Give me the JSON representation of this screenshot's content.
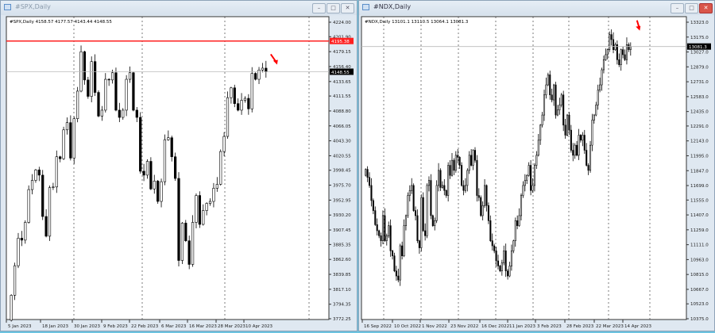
{
  "windows": [
    {
      "title": "#SPX,Daily",
      "info": "#SPX,Daily  4158.57 4177.57 4143.44 4148.55",
      "buttons": {
        "minimize": "–",
        "maximize": "□",
        "close": "✕"
      }
    },
    {
      "title": "#NDX,Daily",
      "info": "#NDX,Daily  13101.1 13110.5 13064.1 13081.3",
      "buttons": {
        "minimize": "–",
        "maximize": "□",
        "close": "✕"
      }
    }
  ],
  "chart_data": [
    {
      "type": "candlestick",
      "symbol": "#SPX",
      "timeframe": "Daily",
      "ylim": [
        3772.25,
        4224.0
      ],
      "price_ticks": [
        "4224.00",
        "4201.90",
        "4179.15",
        "4156.40",
        "4133.65",
        "4111.55",
        "4088.80",
        "4066.05",
        "4043.30",
        "4020.55",
        "3998.45",
        "3975.70",
        "3952.95",
        "3930.20",
        "3907.45",
        "3885.35",
        "3862.60",
        "3839.85",
        "3817.10",
        "3794.35",
        "3772.25"
      ],
      "date_ticks": [
        "5 Jan 2023",
        "18 Jan 2023",
        "30 Jan 2023",
        "9 Feb 2023",
        "22 Feb 2023",
        "6 Mar 2023",
        "16 Mar 2023",
        "28 Mar 2023",
        "10 Apr 2023"
      ],
      "current_price": "4148.55",
      "resistance_level": "4195.38",
      "resistance_color": "#ff2020",
      "arrow_color": "#ff0000",
      "arrow": "down-right",
      "close": [
        3808,
        3853,
        3895,
        3892,
        3919,
        3969,
        3983,
        3999,
        3991,
        3928,
        3898,
        3972,
        3973,
        4019,
        4016,
        4060,
        4071,
        4017,
        4077,
        4119,
        4179,
        4136,
        4111,
        4164,
        4117,
        4081,
        4090,
        4137,
        4136,
        4147,
        4090,
        4079,
        4090,
        4137,
        4147,
        4090,
        4079,
        3997,
        3991,
        4012,
        3970,
        3982,
        3951,
        3981,
        4045,
        4048,
        4019,
        3986,
        3861,
        3918,
        3891,
        3855,
        3919,
        3960,
        3916,
        3937,
        3948,
        3951,
        3971,
        3977,
        4027,
        4050,
        4109,
        4124,
        4100,
        4090,
        4105,
        4108,
        4092,
        4146,
        4137,
        4151,
        4154,
        4148.55
      ]
    },
    {
      "type": "candlestick",
      "symbol": "#NDX",
      "timeframe": "Daily",
      "ylim": [
        10375.0,
        13323.0
      ],
      "price_ticks": [
        "13323.0",
        "13175.0",
        "13027.0",
        "12879.0",
        "12731.0",
        "12583.0",
        "12435.0",
        "12291.0",
        "12143.0",
        "11995.0",
        "11847.0",
        "11699.0",
        "11555.0",
        "11407.0",
        "11259.0",
        "11111.0",
        "10963.0",
        "10815.0",
        "10667.0",
        "10523.0",
        "10375.0"
      ],
      "date_ticks": [
        "16 Sep 2022",
        "10 Oct 2022",
        "1 Nov 2022",
        "23 Nov 2022",
        "16 Dec 2022",
        "11 Jan 2023",
        "3 Feb 2023",
        "28 Feb 2023",
        "22 Mar 2023",
        "14 Apr 2023"
      ],
      "current_price": "13081.3",
      "arrow_color": "#ff0000",
      "arrow": "down",
      "close": [
        11860,
        11780,
        11700,
        11550,
        11450,
        11310,
        11250,
        11200,
        11150,
        11400,
        11150,
        11200,
        11300,
        11050,
        11000,
        10850,
        10800,
        10760,
        11100,
        11000,
        11300,
        11400,
        11600,
        11650,
        11700,
        11450,
        11400,
        11150,
        11080,
        11580,
        11250,
        11200,
        11700,
        11750,
        11400,
        11300,
        11350,
        11700,
        11850,
        11680,
        11700,
        11650,
        11600,
        11900,
        11800,
        11950,
        11850,
        12000,
        11980,
        11900,
        11700,
        11650,
        11700,
        11850,
        12000,
        11900,
        12050,
        11950,
        11600,
        11580,
        11400,
        11500,
        11700,
        11500,
        11350,
        11150,
        11100,
        11050,
        10950,
        10900,
        10850,
        10930,
        11050,
        10850,
        10800,
        10900,
        11050,
        11150,
        11350,
        11300,
        11400,
        11600,
        11700,
        11750,
        11800,
        11900,
        11650,
        11700,
        11900,
        12000,
        12150,
        12300,
        12400,
        12600,
        12700,
        12800,
        12600,
        12550,
        12700,
        12400,
        12450,
        12500,
        12600,
        12300,
        12200,
        12400,
        12250,
        12050,
        12000,
        12100,
        12000,
        12200,
        12150,
        12200,
        12050,
        11900,
        11850,
        12100,
        12350,
        12400,
        12500,
        12650,
        12700,
        12850,
        12950,
        13000,
        13050,
        13200,
        13150,
        13050,
        13100,
        12950,
        12900,
        13050,
        13000,
        12950,
        13100,
        13050,
        13081.3
      ]
    }
  ]
}
